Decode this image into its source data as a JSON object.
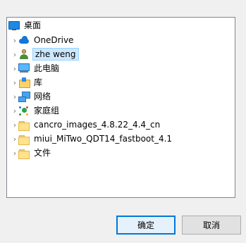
{
  "tree": {
    "root": {
      "label": "桌面",
      "icon": "desktop-icon"
    },
    "items": [
      {
        "label": "OneDrive",
        "icon": "onedrive-cloud-icon"
      },
      {
        "label": "zhe weng",
        "icon": "user-icon"
      },
      {
        "label": "此电脑",
        "icon": "computer-icon"
      },
      {
        "label": "库",
        "icon": "library-icon"
      },
      {
        "label": "网络",
        "icon": "network-icon"
      },
      {
        "label": "家庭组",
        "icon": "homegroup-icon"
      },
      {
        "label": "cancro_images_4.8.22_4.4_cn",
        "icon": "folder-icon"
      },
      {
        "label": "miui_MiTwo_QDT14_fastboot_4.1",
        "icon": "folder-icon"
      },
      {
        "label": "文件",
        "icon": "folder-icon"
      }
    ]
  },
  "buttons": {
    "ok_label": "确定",
    "cancel_label": "取消"
  },
  "colors": {
    "selection_bg": "#cce8ff",
    "selection_border": "#99d1ff",
    "primary_border": "#0078d7"
  }
}
